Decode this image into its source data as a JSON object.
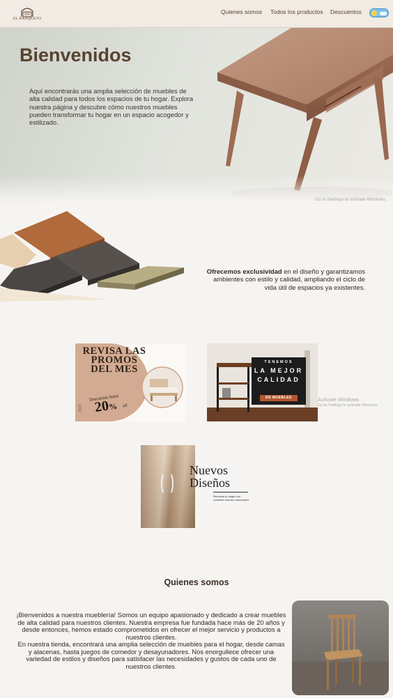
{
  "nav": {
    "logo_text": "EL BANQUETO",
    "links": [
      "Quienes somos",
      "Todos los productos",
      "Descuentos"
    ]
  },
  "hero": {
    "title": "Bienvenidos",
    "description": "Aquí encontrarás una amplia selección de muebles de alta calidad para todos los espacios de tu hogar. Explora nuestra página y descubre cómo nuestros muebles pueden transformar tu hogar en un espacio acogedor y estilizado."
  },
  "exclusivity": {
    "bold_text": "Ofrecemos exclusividad",
    "text": " en el diseño y garantizamos ambientes con estilo y calidad, ampliando el ciclo de vida útil de espacios ya existentes."
  },
  "promos": {
    "card1": {
      "title": "REVISA LAS PROMOS DEL MES",
      "small": "Descuento hasta",
      "percent": "20",
      "percent_suffix": "%",
      "off": "off",
      "year": "2023"
    },
    "card2": {
      "line1": "TENEMOS",
      "line2": "LA MEJOR CALIDAD",
      "line3": "EN MUEBLES"
    },
    "card3": {
      "title": "Nuevos Diseños",
      "small": "Renueva tu hogar con nuestras nuevas colecciones"
    }
  },
  "watermarks": {
    "hero": "Go to Settings to activate Windows.",
    "promo_title": "Activate Windows",
    "promo_sub": "Go to Settings to activate Windows."
  },
  "about": {
    "title": "Quienes somos",
    "text": "¡Bienvenidos a nuestra mueblería! Somos un equipo apasionado y dedicado a crear muebles de alta calidad para nuestros clientes. Nuestra empresa fue fundada hace más de 20 años y desde entonces, hemos estado comprometidos en ofrecer el mejor servicio y productos a nuestros clientes.\nEn nuestra tienda, encontrará una amplia selección de muebles para el hogar, desde camas y alacenas, hasta juegos de comedor y desayunadores. Nos enorgullece ofrecer una variedad de estilos y diseños para satisfacer las necesidades y gustos de cada uno de nuestros clientes."
  },
  "colors": {
    "nav_bg": "#f1ebe4",
    "title_brown": "#574330",
    "promo_tan": "#d3ab92",
    "accent_orange": "#b4562c"
  }
}
